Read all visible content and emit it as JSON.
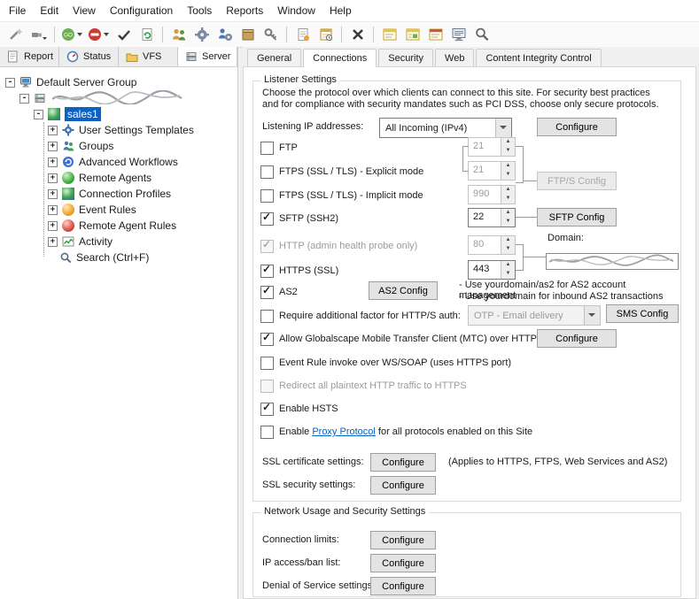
{
  "menubar": {
    "items": [
      {
        "label": "File"
      },
      {
        "label": "Edit"
      },
      {
        "label": "View"
      },
      {
        "label": "Configuration"
      },
      {
        "label": "Tools"
      },
      {
        "label": "Reports"
      },
      {
        "label": "Window"
      },
      {
        "label": "Help"
      }
    ]
  },
  "left": {
    "tabs": [
      {
        "label": "Report"
      },
      {
        "label": "Status"
      },
      {
        "label": "VFS"
      },
      {
        "label": "Server"
      }
    ],
    "tree": {
      "root": {
        "label": "Default Server Group",
        "exp": "-"
      },
      "server": {
        "exp": "-"
      },
      "site": {
        "label": "sales1",
        "exp": "-"
      },
      "items": [
        {
          "label": "User Settings Templates",
          "exp": "+"
        },
        {
          "label": "Groups",
          "exp": "+"
        },
        {
          "label": "Advanced Workflows",
          "exp": "+"
        },
        {
          "label": "Remote Agents",
          "exp": "+"
        },
        {
          "label": "Connection Profiles",
          "exp": "+"
        },
        {
          "label": "Event Rules",
          "exp": "+"
        },
        {
          "label": "Remote Agent Rules",
          "exp": "+"
        },
        {
          "label": "Activity",
          "exp": "+"
        },
        {
          "label": "Search (Ctrl+F)"
        }
      ]
    }
  },
  "right": {
    "tabs": [
      {
        "label": "General"
      },
      {
        "label": "Connections"
      },
      {
        "label": "Security"
      },
      {
        "label": "Web"
      },
      {
        "label": "Content Integrity Control"
      }
    ],
    "active_tab": "Connections"
  },
  "listener": {
    "title": "Listener Settings",
    "intro1": "Choose the protocol over which clients can connect to this site. For security best practices",
    "intro2": "and for compliance with security mandates such as PCI DSS, choose only secure protocols.",
    "ip_label": "Listening IP addresses:",
    "ip_value": "All Incoming (IPv4)",
    "ip_configure": "Configure",
    "ftp": {
      "label": "FTP",
      "checked": false,
      "port": "21"
    },
    "ftps_explicit": {
      "label": "FTPS (SSL / TLS) - Explicit mode",
      "checked": false,
      "port": "21",
      "button": "FTP/S Config"
    },
    "ftps_implicit": {
      "label": "FTPS (SSL / TLS) - Implicit mode",
      "checked": false,
      "port": "990"
    },
    "sftp": {
      "label": "SFTP (SSH2)",
      "checked": true,
      "port": "22",
      "button": "SFTP Config"
    },
    "http": {
      "label": "HTTP (admin health probe only)",
      "checked": true,
      "port": "80"
    },
    "domain_label": "Domain:",
    "https": {
      "label": "HTTPS (SSL)",
      "checked": true,
      "port": "443"
    },
    "as2": {
      "label": "AS2",
      "checked": true,
      "button": "AS2 Config",
      "note1": "- Use yourdomain/as2 for AS2 account management",
      "note2": "- Use yourdomain for inbound AS2 transactions"
    },
    "otp": {
      "label": "Require additional factor for HTTP/S auth:",
      "checked": false,
      "value": "OTP - Email delivery",
      "button": "SMS Config"
    },
    "mtc": {
      "label": "Allow Globalscape Mobile Transfer Client (MTC) over HTTPS",
      "checked": true,
      "button": "Configure"
    },
    "soap": {
      "label": "Event Rule invoke over WS/SOAP (uses HTTPS port)",
      "checked": false
    },
    "redirect": {
      "label": "Redirect all plaintext HTTP traffic to HTTPS",
      "checked": false
    },
    "hsts": {
      "label": "Enable HSTS",
      "checked": true
    },
    "proxy": {
      "prefix": "Enable ",
      "link": "Proxy Protocol",
      "suffix": " for all protocols enabled on this Site",
      "checked": false
    },
    "ssl_cert": {
      "label": "SSL certificate settings:",
      "button": "Configure",
      "note": "(Applies to HTTPS, FTPS, Web Services and AS2)"
    },
    "ssl_sec": {
      "label": "SSL security settings:",
      "button": "Configure"
    }
  },
  "network": {
    "title": "Network Usage and Security Settings",
    "rows": [
      {
        "label": "Connection limits:",
        "button": "Configure"
      },
      {
        "label": "IP access/ban list:",
        "button": "Configure"
      },
      {
        "label": "Denial of Service settings:",
        "button": "Configure"
      }
    ]
  }
}
